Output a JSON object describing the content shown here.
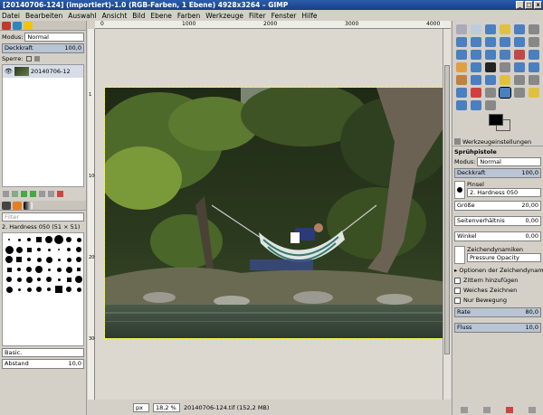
{
  "window": {
    "title": "[20140706-124] (importiert)-1.0 (RGB-Farben, 1 Ebene) 4928x3264 – GIMP",
    "btn_min": "_",
    "btn_max": "□",
    "btn_close": "x"
  },
  "menu": [
    "Datei",
    "Bearbeiten",
    "Auswahl",
    "Ansicht",
    "Bild",
    "Ebene",
    "Farben",
    "Werkzeuge",
    "Filter",
    "Fenster",
    "Hilfe"
  ],
  "layers": {
    "mode_label": "Modus:",
    "mode_value": "Normal",
    "opacity_label": "Deckkraft",
    "opacity_value": "100,0",
    "lock_label": "Sperre:",
    "layer_name": "20140706-12"
  },
  "brushes": {
    "filter_placeholder": "Filter",
    "brush_name": "2. Hardness 050 (51 × 51)",
    "preset_value": "Basic.",
    "spacing_label": "Abstand",
    "spacing_value": "10,0"
  },
  "ruler": {
    "ticks": [
      "0",
      "1000",
      "2000",
      "3000",
      "4000"
    ],
    "side_ticks": [
      "1",
      "1000",
      "2000",
      "3000"
    ]
  },
  "statusbar": {
    "unit": "px",
    "zoom": "18,2 %",
    "file_info": "20140706-124.tif (152,2 MB)"
  },
  "tool_options": {
    "tab_title": "Werkzeugeinstellungen",
    "tool_name": "Sprühpistole",
    "mode_label": "Modus:",
    "mode_value": "Normal",
    "opacity_label": "Deckkraft",
    "opacity_value": "100,0",
    "brush_label": "Pinsel",
    "brush_value": "2. Hardness 050",
    "size_label": "Größe",
    "size_value": "20,00",
    "aspect_label": "Seitenverhältnis",
    "aspect_value": "0,00",
    "angle_label": "Winkel",
    "angle_value": "0,00",
    "dynamics_label": "Zeichendynamiken",
    "dynamics_value": "Pressure Opacity",
    "dyn_options_label": "Optionen der Zeichendynamik",
    "jitter_label": "Zittern hinzufügen",
    "smooth_label": "Weiches Zeichnen",
    "incremental_label": "Nur Bewegung",
    "rate_label": "Rate",
    "rate_value": "80,0",
    "flow_label": "Fluss",
    "flow_value": "10,0"
  },
  "colors": {
    "accent": "#b9c4d4",
    "titlebar": "#1a3f88",
    "fg_color": "#000000",
    "bg_color": "#ffffff"
  }
}
